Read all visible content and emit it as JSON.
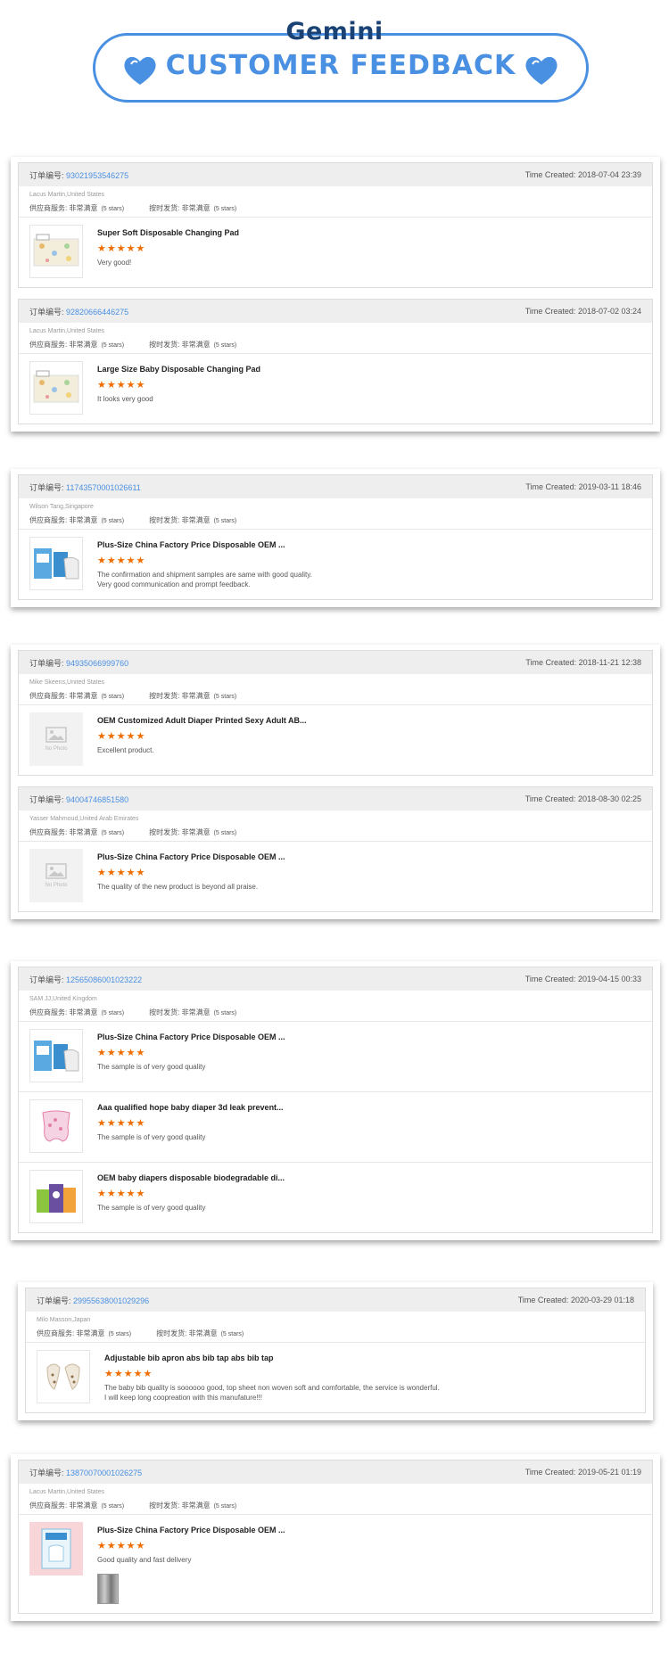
{
  "header": {
    "brand": "Gemini",
    "title": "CUSTOMER FEEDBACK",
    "accent_color": "#4a90e2"
  },
  "labels": {
    "order_no": "订单编号:",
    "time_created": "Time Created:",
    "supplier_service": "供应商服务: 非常满意",
    "on_time_delivery": "按时发货: 非常满意",
    "five_stars": "(5 stars)",
    "no_photo": "No Photo",
    "stars": "★★★★★"
  },
  "orders": [
    {
      "number": "93021953546275",
      "time": "2018-07-04 23:39",
      "buyer": "Lacus Martin,United States",
      "items": [
        {
          "title": "Super Soft Disposable Changing Pad",
          "review": "Very good!",
          "thumb": "changing-pad"
        }
      ]
    },
    {
      "number": "92820666446275",
      "time": "2018-07-02 03:24",
      "buyer": "Lacus Martin,United States",
      "items": [
        {
          "title": "Large Size Baby Disposable Changing Pad",
          "review": "It looks very good",
          "thumb": "changing-pad"
        }
      ]
    },
    {
      "number": "11743570001026611",
      "time": "2019-03-11 18:46",
      "buyer": "Wilson Tang,Singapore",
      "items": [
        {
          "title": "Plus-Size China Factory Price Disposable OEM ...",
          "review": "The confirmation and shipment samples are same with good quality.",
          "review2": "Very good communication and prompt feedback.",
          "thumb": "adult-diaper"
        }
      ]
    },
    {
      "number": "94935066999760",
      "time": "2018-11-21 12:38",
      "buyer": "Mike Skeens,United States",
      "items": [
        {
          "title": "OEM Customized Adult Diaper Printed Sexy Adult AB...",
          "review": "Excellent product.",
          "thumb": "no-photo"
        }
      ]
    },
    {
      "number": "94004746851580",
      "time": "2018-08-30 02:25",
      "buyer": "Yasser Mahmoud,United Arab Emirates",
      "items": [
        {
          "title": "Plus-Size China Factory Price Disposable OEM ...",
          "review": "The quality of the new product is beyond all praise.",
          "thumb": "no-photo"
        }
      ]
    },
    {
      "number": "12565086001023222",
      "time": "2019-04-15 00:33",
      "buyer": "SAM JJ,United Kingdom",
      "items": [
        {
          "title": "Plus-Size China Factory Price Disposable OEM ...",
          "review": "The sample is of very good quality",
          "thumb": "adult-diaper"
        },
        {
          "title": "Aaa qualified hope baby diaper 3d leak prevent...",
          "review": "The sample is of very good quality",
          "thumb": "baby-diaper"
        },
        {
          "title": "OEM baby diapers disposable biodegradable di...",
          "review": "The sample is of very good quality",
          "thumb": "diaper-packs"
        }
      ]
    },
    {
      "number": "29955638001029296",
      "time": "2020-03-29 01:18",
      "buyer": "Milo Masson,Japan",
      "items": [
        {
          "title": "Adjustable bib apron abs bib tap abs bib tap",
          "review": "The baby bib quality is soooooo good, top sheet non woven soft and comfortable, the service is wonderful.",
          "review2": "I will keep long coopreation with this manufature!!!",
          "thumb": "bibs"
        }
      ]
    },
    {
      "number": "13870070001026275",
      "time": "2019-05-21 01:19",
      "buyer": "Lacus Martin,United States",
      "items": [
        {
          "title": "Plus-Size China Factory Price Disposable OEM ...",
          "review": "Good quality and fast delivery",
          "thumb": "adult-tape"
        }
      ]
    }
  ]
}
